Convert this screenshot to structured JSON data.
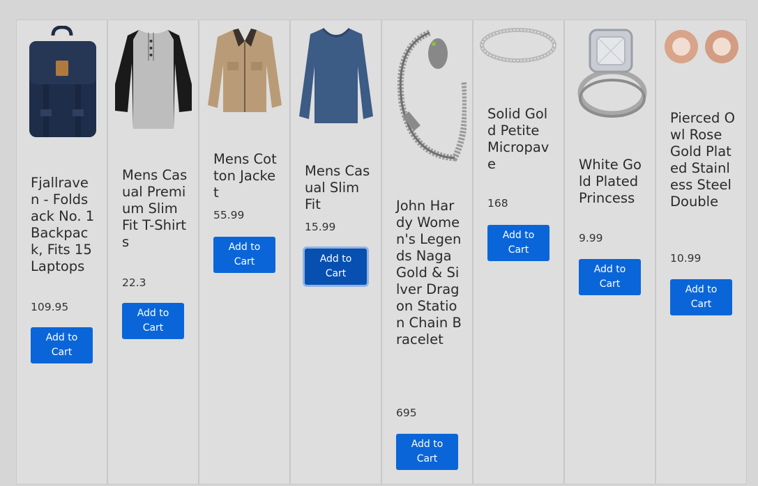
{
  "products": [
    {
      "title": "Fjallraven - Foldsack No. 1 Backpack, Fits 15 Laptops",
      "price": "109.95",
      "button_label": "Add to Cart",
      "icon": "backpack-image"
    },
    {
      "title": "Mens Casual Premium Slim Fit T-Shirts",
      "price": "22.3",
      "button_label": "Add to Cart",
      "icon": "tshirt-image"
    },
    {
      "title": "Mens Cotton Jacket",
      "price": "55.99",
      "button_label": "Add to Cart",
      "icon": "jacket-image"
    },
    {
      "title": "Mens Casual Slim Fit",
      "price": "15.99",
      "button_label": "Add to Cart",
      "icon": "longsleeve-image"
    },
    {
      "title": "John Hardy Women's Legends Naga Gold & Silver Dragon Station Chain Bracelet",
      "price": "695",
      "button_label": "Add to Cart",
      "icon": "bracelet-image"
    },
    {
      "title": "Solid Gold Petite Micropave",
      "price": "168",
      "button_label": "Add to Cart",
      "icon": "ring-image"
    },
    {
      "title": "White Gold Plated Princess",
      "price": "9.99",
      "button_label": "Add to Cart",
      "icon": "engagement-ring-image"
    },
    {
      "title": "Pierced Owl Rose Gold Plated Stainless Steel Double",
      "price": "10.99",
      "button_label": "Add to Cart",
      "icon": "plugs-image"
    }
  ],
  "colors": {
    "button": "#0a66d8",
    "card": "#dedede",
    "background": "#d6d6d6"
  }
}
